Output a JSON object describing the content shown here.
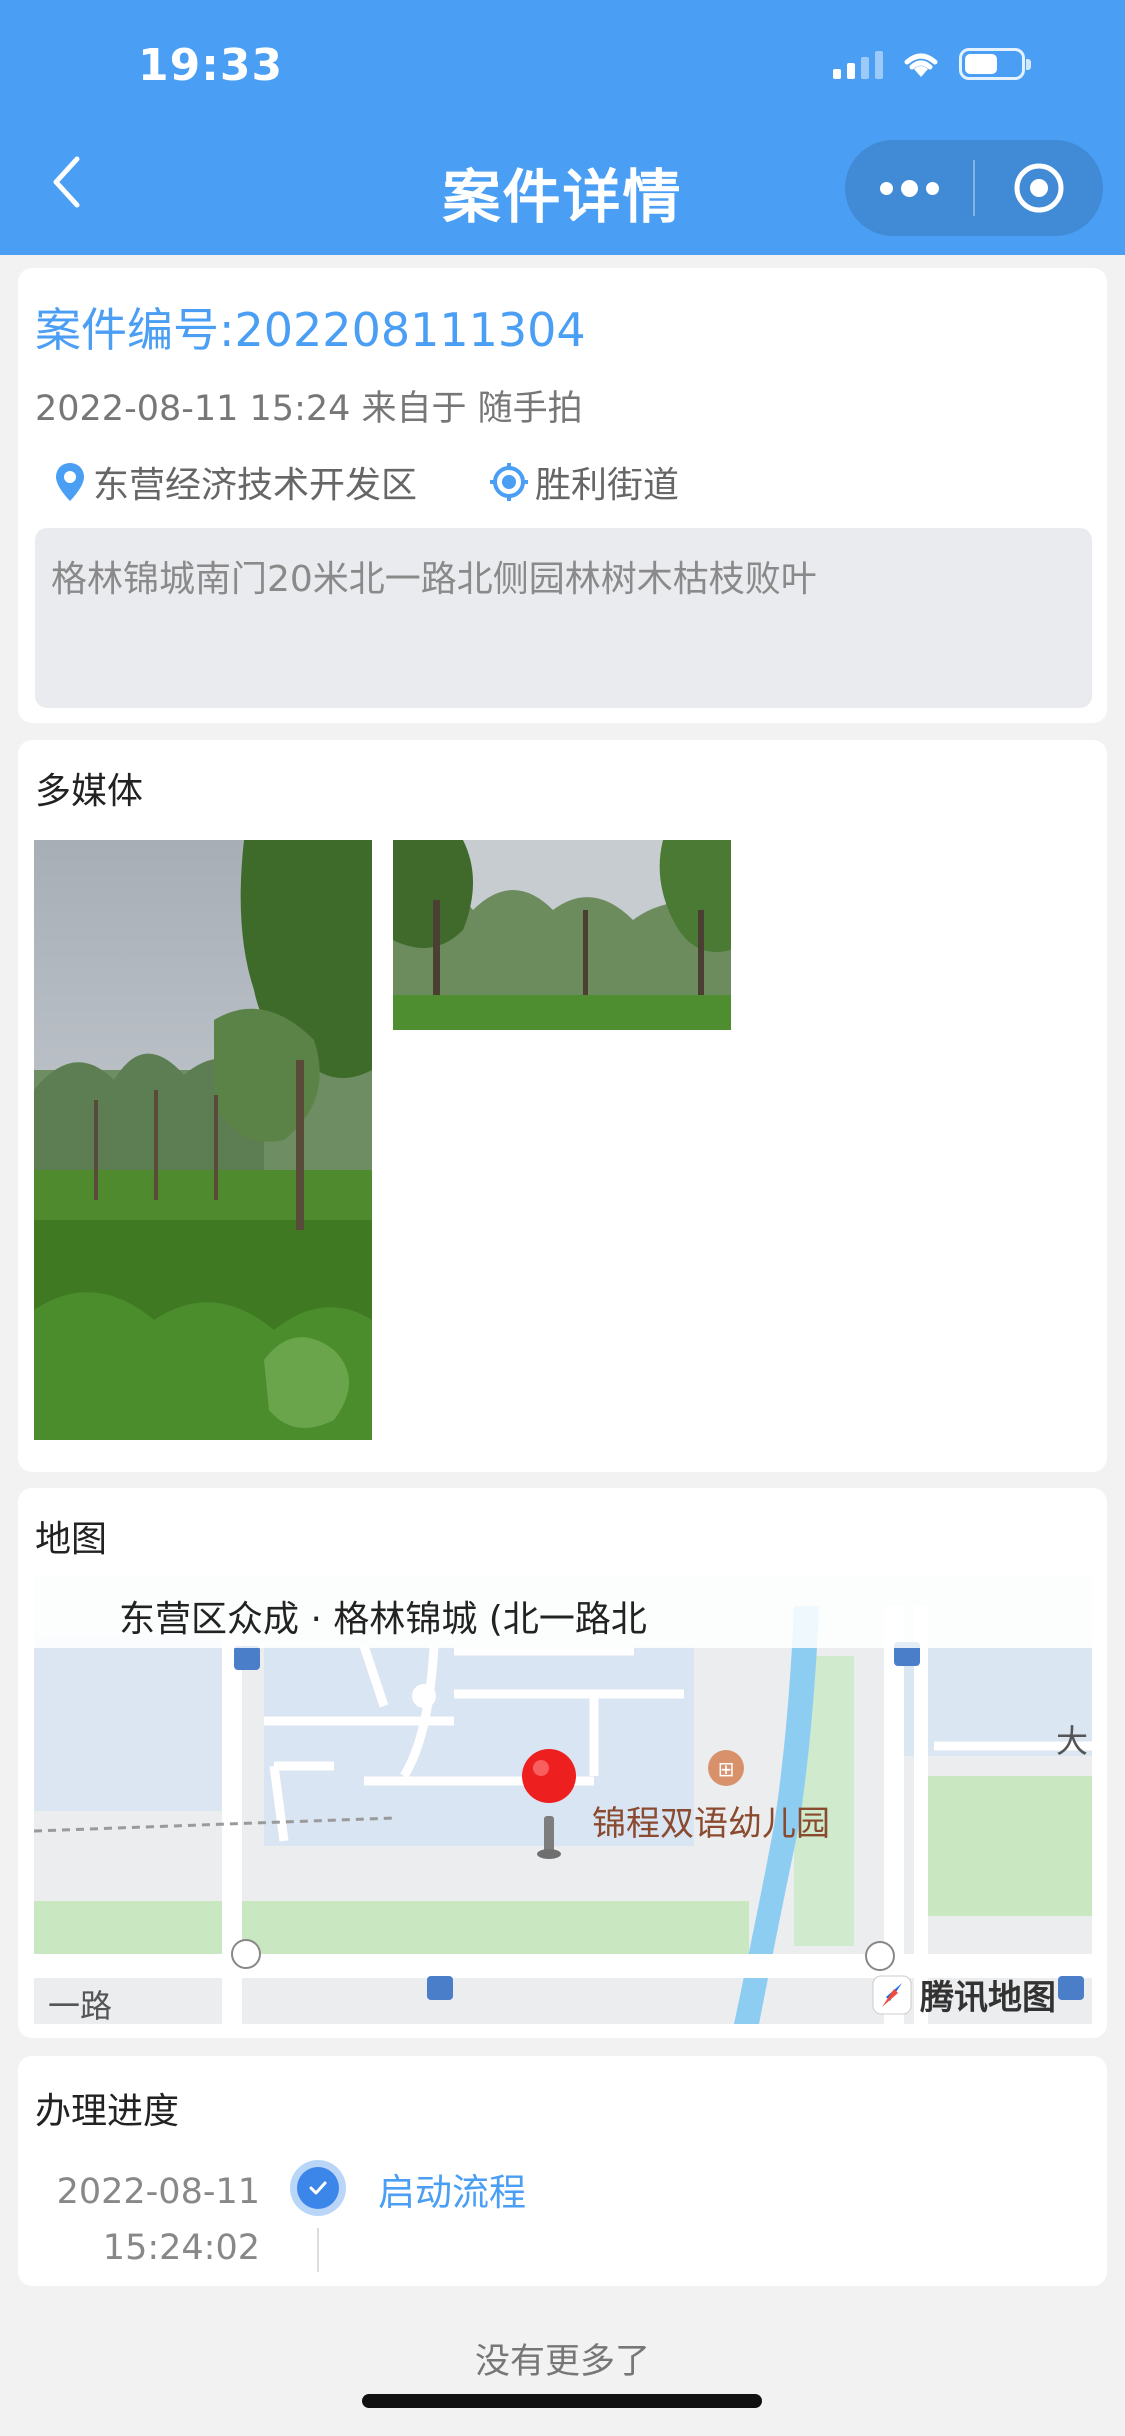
{
  "status_bar": {
    "time": "19:33"
  },
  "header": {
    "title": "案件详情"
  },
  "case": {
    "number": "案件编号:202208111304",
    "meta": "2022-08-11 15:24 来自于 随手拍",
    "district": "东营经济技术开发区",
    "street": "胜利街道",
    "description": "格林锦城南门20米北一路北侧园林树木枯枝败叶"
  },
  "media": {
    "title": "多媒体"
  },
  "map": {
    "title": "地图",
    "address": "东营区众成 · 格林锦城 (北一路北",
    "poi_label": "锦程双语幼儿园",
    "road_label": "一路",
    "edge_label": "大",
    "brand": "腾讯地图"
  },
  "progress": {
    "title": "办理进度",
    "items": [
      {
        "date": "2022-08-11",
        "time": "15:24:02",
        "step": "启动流程"
      }
    ]
  },
  "footer": {
    "no_more": "没有更多了"
  }
}
